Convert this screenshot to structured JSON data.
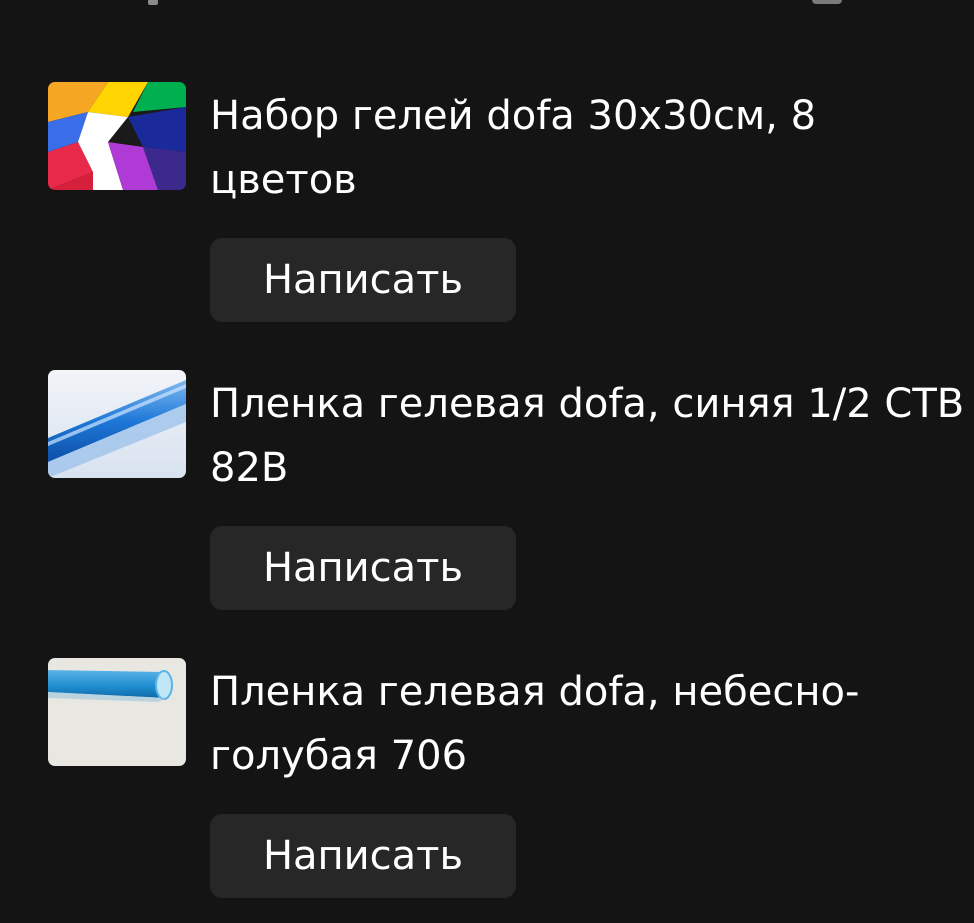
{
  "products": [
    {
      "title_line1": "Набор гелей dofa 30x30см, 8",
      "title_line2": "цветов",
      "button_label": "Написать",
      "thumbnail_icon": "color-gel-swatches-image"
    },
    {
      "title_line1": "Пленка гелевая dofa, синяя 1/2 CTB",
      "title_line2": "82B",
      "button_label": "Написать",
      "thumbnail_icon": "blue-gel-film-image"
    },
    {
      "title_line1": "Пленка гелевая dofa, небесно-",
      "title_line2": "голубая 706",
      "button_label": "Написать",
      "thumbnail_icon": "sky-blue-gel-roll-image"
    }
  ],
  "colors": {
    "background": "#141414",
    "button_background": "#272727",
    "text": "#ffffff"
  }
}
